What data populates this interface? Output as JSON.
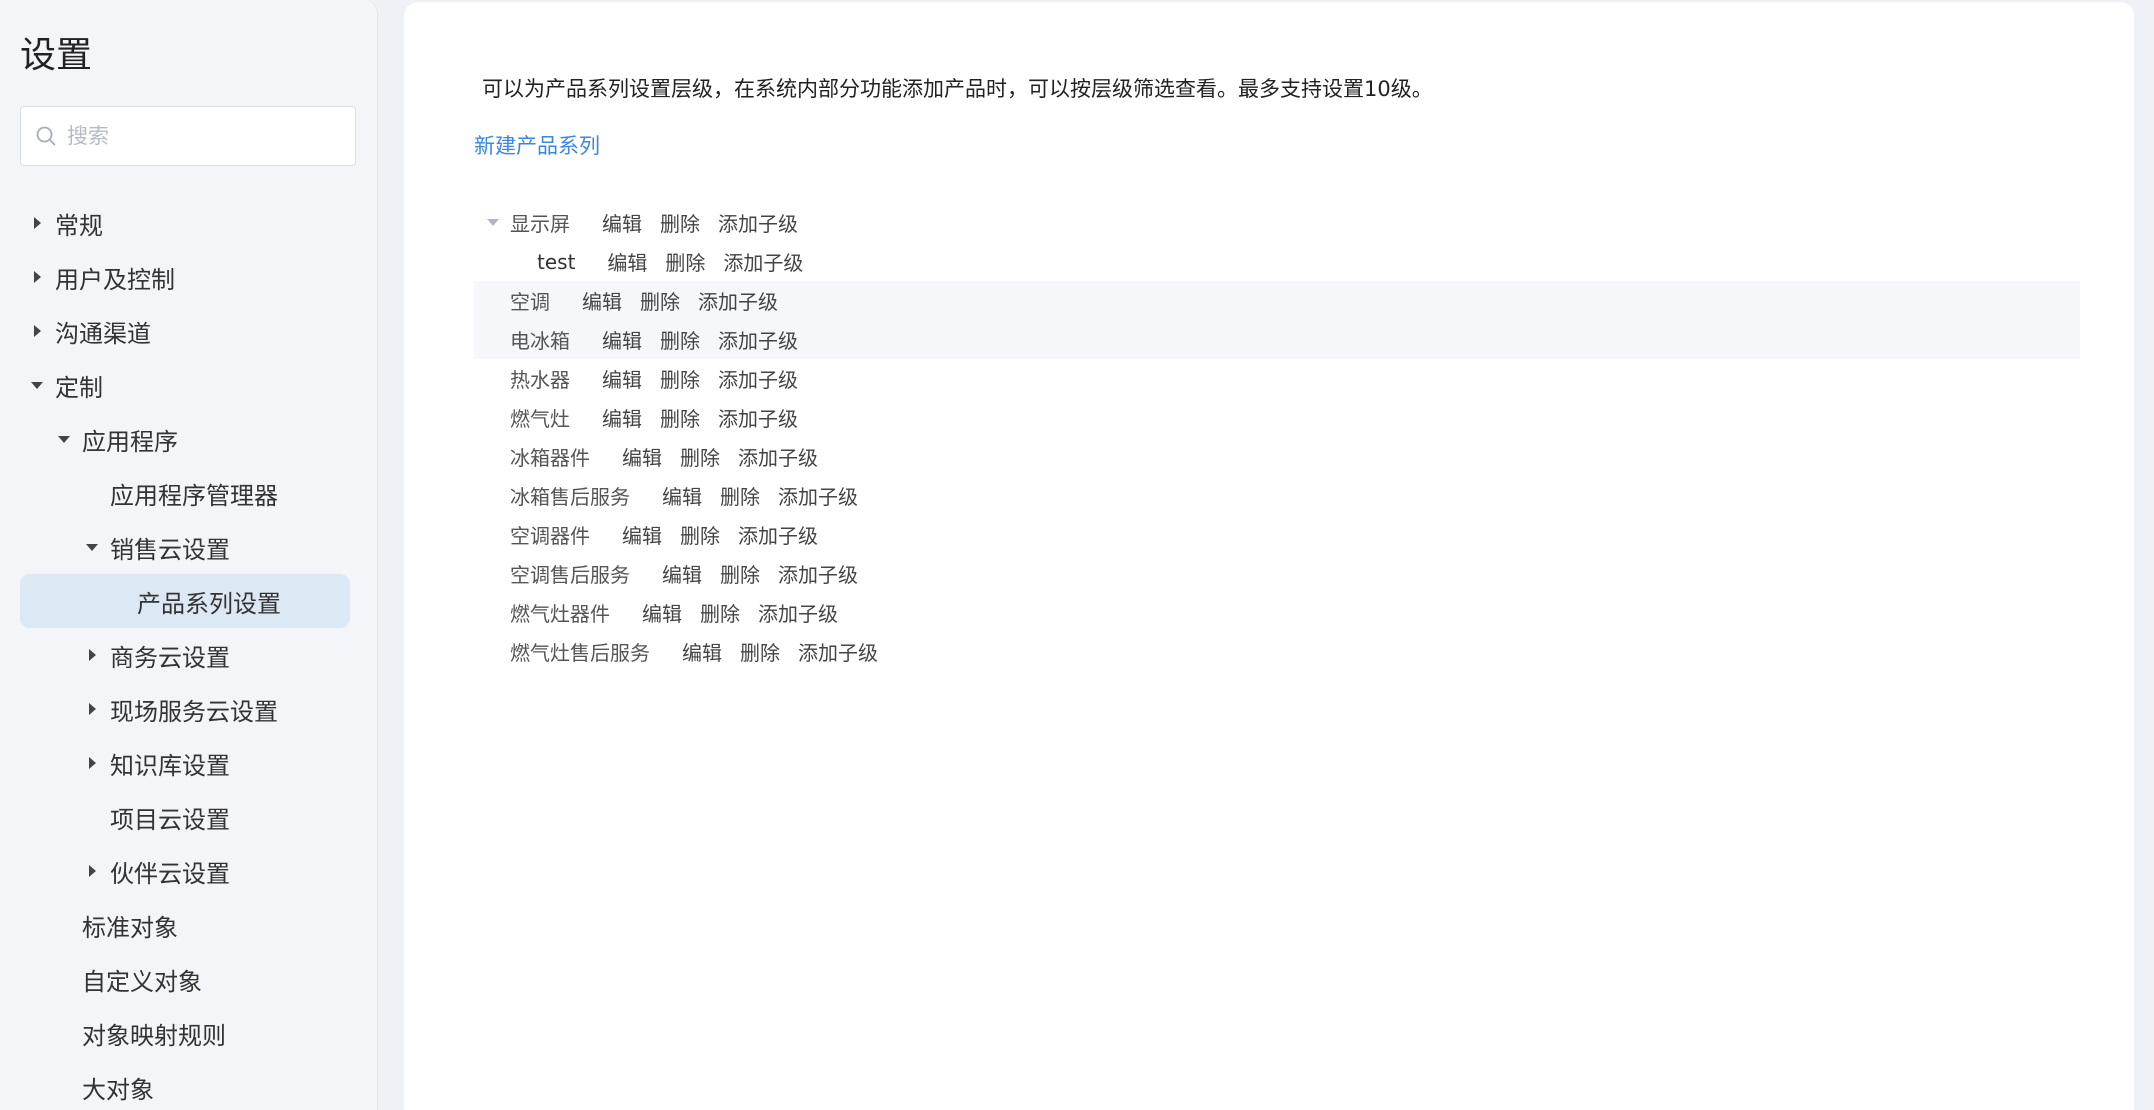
{
  "sidebar": {
    "title": "设置",
    "search_placeholder": "搜索",
    "items": [
      {
        "label": "常规",
        "caret": "right"
      },
      {
        "label": "用户及控制",
        "caret": "right"
      },
      {
        "label": "沟通渠道",
        "caret": "right"
      },
      {
        "label": "定制",
        "caret": "down"
      },
      {
        "label": "应用程序",
        "caret": "down"
      },
      {
        "label": "应用程序管理器",
        "caret": "none"
      },
      {
        "label": "销售云设置",
        "caret": "down"
      },
      {
        "label": "产品系列设置",
        "caret": "none",
        "active": true
      },
      {
        "label": "商务云设置",
        "caret": "right"
      },
      {
        "label": "现场服务云设置",
        "caret": "right"
      },
      {
        "label": "知识库设置",
        "caret": "right"
      },
      {
        "label": "项目云设置",
        "caret": "none"
      },
      {
        "label": "伙伴云设置",
        "caret": "right"
      },
      {
        "label": "标准对象",
        "caret": "none"
      },
      {
        "label": "自定义对象",
        "caret": "none"
      },
      {
        "label": "对象映射规则",
        "caret": "none"
      },
      {
        "label": "大对象",
        "caret": "none"
      }
    ]
  },
  "main": {
    "intro": "可以为产品系列设置层级，在系统内部分功能添加产品时，可以按层级筛选查看。最多支持设置10级。",
    "new_link": "新建产品系列",
    "actions": {
      "edit": "编辑",
      "delete": "删除",
      "add_child": "添加子级"
    },
    "tree": [
      {
        "label": "显示屏",
        "expanded": true
      },
      {
        "label": "test",
        "child": true
      },
      {
        "label": "空调"
      },
      {
        "label": "电冰箱"
      },
      {
        "label": "热水器"
      },
      {
        "label": "燃气灶"
      },
      {
        "label": "冰箱器件"
      },
      {
        "label": "冰箱售后服务"
      },
      {
        "label": "空调器件"
      },
      {
        "label": "空调售后服务"
      },
      {
        "label": "燃气灶器件"
      },
      {
        "label": "燃气灶售后服务"
      }
    ]
  },
  "colors": {
    "accent": "#3a86e0",
    "active_bg": "#dde8f5",
    "row_highlight": "#f5f7fa"
  }
}
